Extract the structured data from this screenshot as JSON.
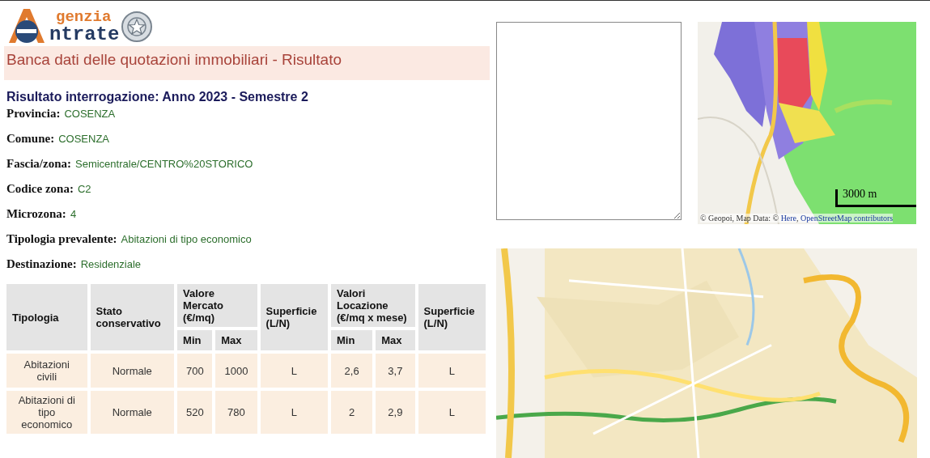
{
  "logo": {
    "line_1": "genzia",
    "line_2": "ntrate"
  },
  "page_title": "Banca dati delle quotazioni immobiliari - Risultato",
  "result_heading": "Risultato interrogazione: Anno 2023 - Semestre 2",
  "fields": [
    {
      "label": "Provincia:",
      "value": "COSENZA"
    },
    {
      "label": "Comune:",
      "value": "COSENZA"
    },
    {
      "label": "Fascia/zona:",
      "value": "Semicentrale/CENTRO%20STORICO"
    },
    {
      "label": "Codice zona:",
      "value": "C2"
    },
    {
      "label": "Microzona:",
      "value": "4"
    },
    {
      "label": "Tipologia prevalente:",
      "value": "Abitazioni di tipo economico"
    },
    {
      "label": "Destinazione:",
      "value": "Residenziale"
    }
  ],
  "table": {
    "columns": [
      {
        "label": "Tipologia"
      },
      {
        "label": "Stato conservativo"
      },
      {
        "label": "Valore Mercato (€/mq)",
        "colspan": 2,
        "subcolumns": [
          "Min",
          "Max"
        ]
      },
      {
        "label": "Superficie (L/N)"
      },
      {
        "label": "Valori Locazione (€/mq x mese)",
        "colspan": 2,
        "subcolumns": [
          "Min",
          "Max"
        ]
      },
      {
        "label": "Superficie (L/N)"
      }
    ],
    "rows": [
      [
        "Abitazioni civili",
        "Normale",
        "700",
        "1000",
        "L",
        "2,6",
        "3,7",
        "L"
      ],
      [
        "Abitazioni di tipo economico",
        "Normale",
        "520",
        "780",
        "L",
        "2",
        "2,9",
        "L"
      ]
    ]
  },
  "small_map": {
    "scale": "3000 m",
    "attribution": "© Geopoi, Map Data: © ",
    "links": [
      "Here",
      "OpenStreetMap contributors"
    ],
    "link_separator": ", "
  }
}
